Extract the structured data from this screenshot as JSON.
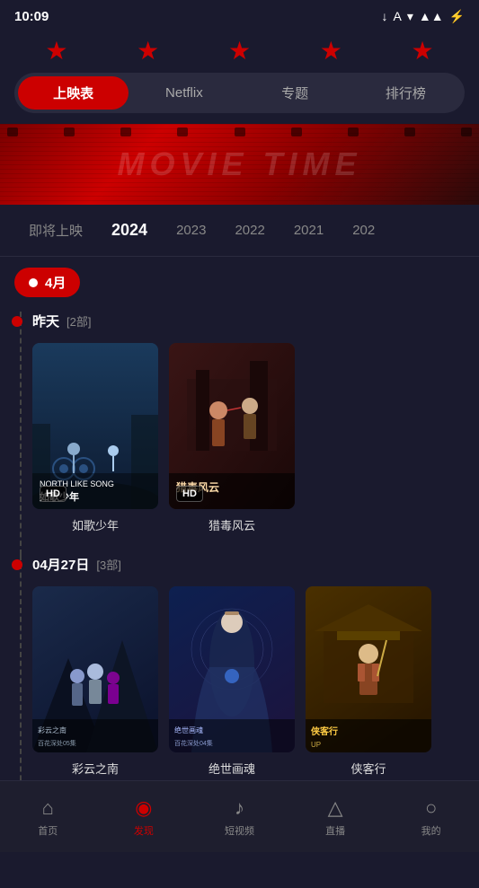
{
  "statusBar": {
    "time": "10:09",
    "icons": [
      "↓",
      "A",
      "▼",
      "▲",
      "⚡"
    ]
  },
  "stars": [
    "★",
    "★",
    "★",
    "★",
    "★"
  ],
  "tabs": [
    {
      "id": "schedule",
      "label": "上映表",
      "active": true
    },
    {
      "id": "netflix",
      "label": "Netflix",
      "active": false
    },
    {
      "id": "topics",
      "label": "专题",
      "active": false
    },
    {
      "id": "ranking",
      "label": "排行榜",
      "active": false
    }
  ],
  "hero": {
    "text": "MOVIE TIME"
  },
  "yearTabs": [
    {
      "id": "upcoming",
      "label": "即将上映",
      "active": false
    },
    {
      "id": "2024",
      "label": "2024",
      "active": true
    },
    {
      "id": "2023",
      "label": "2023",
      "active": false
    },
    {
      "id": "2022",
      "label": "2022",
      "active": false
    },
    {
      "id": "2021",
      "label": "2021",
      "active": false
    },
    {
      "id": "2020",
      "label": "202",
      "active": false
    }
  ],
  "monthBadge": "4月",
  "sections": [
    {
      "id": "yesterday",
      "title": "昨天",
      "count": "[2部]",
      "movies": [
        {
          "id": "movie1",
          "title": "如歌少年",
          "badge": "HD",
          "posterTheme": "poster-1",
          "posterText": "如歌少年\nNORTH LIKE SONG"
        },
        {
          "id": "movie2",
          "title": "猎毒风云",
          "badge": "HD",
          "posterTheme": "poster-2",
          "posterText": "猎毒风云"
        }
      ]
    },
    {
      "id": "apr27",
      "title": "04月27日",
      "count": "[3部]",
      "movies": [
        {
          "id": "movie3",
          "title": "彩云之南",
          "badge": "",
          "posterTheme": "poster-3",
          "posterText": "彩云之南\n百花深处05集"
        },
        {
          "id": "movie4",
          "title": "绝世画魂",
          "badge": "",
          "posterTheme": "poster-4",
          "posterText": "绝世画魂\n百花深处04集"
        },
        {
          "id": "movie5",
          "title": "侠客行",
          "badge": "",
          "posterTheme": "poster-5",
          "posterText": "侠客行\nUP"
        }
      ]
    }
  ],
  "bottomNav": [
    {
      "id": "home",
      "icon": "🏠",
      "label": "首页",
      "active": false
    },
    {
      "id": "discover",
      "icon": "🔍",
      "label": "发现",
      "active": true
    },
    {
      "id": "short-video",
      "icon": "🎵",
      "label": "短视频",
      "active": false
    },
    {
      "id": "live",
      "icon": "📡",
      "label": "直播",
      "active": false
    },
    {
      "id": "profile",
      "icon": "👤",
      "label": "我的",
      "active": false
    }
  ]
}
